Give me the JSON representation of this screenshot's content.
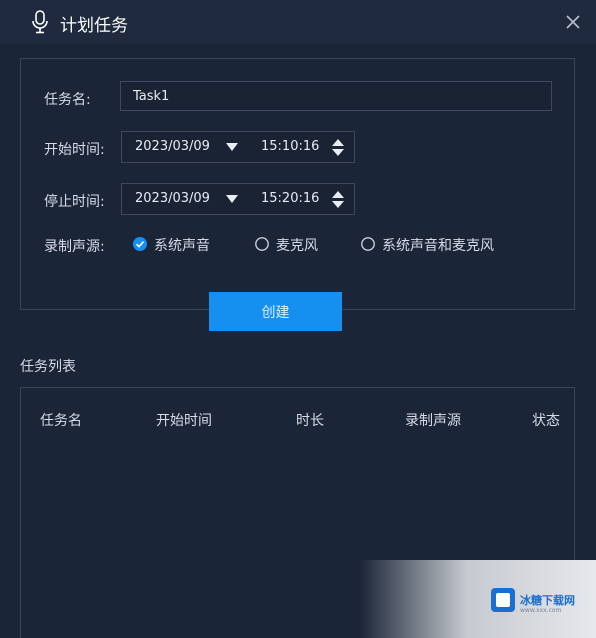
{
  "window": {
    "title": "计划任务"
  },
  "icons": {
    "title": "microphone-icon",
    "close": "close-icon",
    "date_caret": "caret-down-icon",
    "time_spin": "spinner-icon",
    "radio_checked": "check-circle-icon"
  },
  "colors": {
    "background": "#1b2538",
    "titlebar": "#1f2a3e",
    "accent": "#1590f0",
    "border": "#3a4559",
    "text": "#d6dbe6"
  },
  "form": {
    "task_name_label": "任务名:",
    "task_name_value": "Task1",
    "start_label": "开始时间:",
    "start_date": "2023/03/09",
    "start_time": "15:10:16",
    "stop_label": "停止时间:",
    "stop_date": "2023/03/09",
    "stop_time": "15:20:16",
    "source_label": "录制声源:",
    "sources": [
      {
        "label": "系统声音",
        "checked": true
      },
      {
        "label": "麦克风",
        "checked": false
      },
      {
        "label": "系统声音和麦克风",
        "checked": false
      }
    ],
    "create_label": "创建"
  },
  "task_list": {
    "title": "任务列表",
    "columns": [
      "任务名",
      "开始时间",
      "时长",
      "录制声源",
      "状态"
    ],
    "rows": []
  },
  "watermark": {
    "text": "冰糖下载网",
    "sub": "www.xxx.com"
  }
}
